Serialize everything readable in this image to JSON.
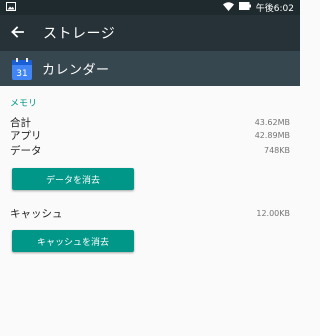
{
  "status_bar": {
    "time": "午後6:02"
  },
  "toolbar": {
    "title": "ストレージ"
  },
  "app": {
    "name": "カレンダー",
    "icon_day": "31"
  },
  "memory": {
    "section_label": "メモリ",
    "rows": [
      {
        "label": "合計",
        "value": "43.62MB"
      },
      {
        "label": "アプリ",
        "value": "42.89MB"
      },
      {
        "label": "データ",
        "value": "748KB"
      }
    ],
    "clear_data_label": "データを消去"
  },
  "cache": {
    "label": "キャッシュ",
    "value": "12.00KB",
    "clear_cache_label": "キャッシュを消去"
  },
  "colors": {
    "accent": "#009688",
    "toolbar_bg": "#263238",
    "app_header_bg": "#37474f",
    "status_bar_bg": "#1f2a2e"
  },
  "icons": [
    "image-icon",
    "wifi-icon",
    "battery-icon",
    "back-arrow-icon",
    "calendar-app-icon"
  ]
}
